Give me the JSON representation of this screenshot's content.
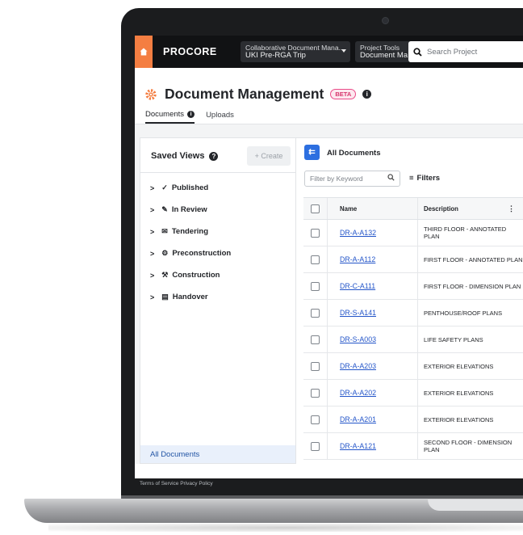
{
  "topnav": {
    "logo": "PROCORE",
    "company": {
      "line1": "Collaborative Document Mana...",
      "line2": "UKI Pre-RGA Trip"
    },
    "tool": {
      "line1": "Project Tools",
      "line2": "Document Ma..."
    },
    "search_placeholder": "Search Project"
  },
  "header": {
    "title": "Document Management",
    "badge": "BETA",
    "info_glyph": "i",
    "tabs": [
      {
        "label": "Documents"
      },
      {
        "label": "Uploads"
      }
    ]
  },
  "sidebar": {
    "title": "Saved Views",
    "help_glyph": "?",
    "create_label": "+ Create",
    "items": [
      {
        "label": "Published",
        "icon": "✓"
      },
      {
        "label": "In Review",
        "icon": "✎"
      },
      {
        "label": "Tendering",
        "icon": "✉"
      },
      {
        "label": "Preconstruction",
        "icon": "⚙"
      },
      {
        "label": "Construction",
        "icon": "⚒"
      },
      {
        "label": "Handover",
        "icon": "▤"
      }
    ],
    "selected_label": "All Documents"
  },
  "main": {
    "back_glyph": "⇇",
    "title": "All Documents",
    "filter_placeholder": "Filter by Keyword",
    "filters_label": "Filters",
    "columns": {
      "name": "Name",
      "description": "Description"
    },
    "rows": [
      {
        "name": "DR-A-A132",
        "description": "THIRD FLOOR - ANNOTATED PLAN"
      },
      {
        "name": "DR-A-A112",
        "description": "FIRST FLOOR - ANNOTATED PLAN"
      },
      {
        "name": "DR-C-A111",
        "description": "FIRST FLOOR - DIMENSION PLAN"
      },
      {
        "name": "DR-S-A141",
        "description": "PENTHOUSE/ROOF PLANS"
      },
      {
        "name": "DR-S-A003",
        "description": "LIFE SAFETY PLANS"
      },
      {
        "name": "DR-A-A203",
        "description": "EXTERIOR ELEVATIONS"
      },
      {
        "name": "DR-A-A202",
        "description": "EXTERIOR ELEVATIONS"
      },
      {
        "name": "DR-A-A201",
        "description": "EXTERIOR ELEVATIONS"
      },
      {
        "name": "DR-A-A121",
        "description": "SECOND FLOOR - DIMENSION PLAN"
      }
    ]
  },
  "footer": {
    "text": "Terms of Service  Privacy Policy"
  },
  "colors": {
    "brand": "#f47e42",
    "accent": "#2d6fe0",
    "nav_bg": "#111214"
  }
}
